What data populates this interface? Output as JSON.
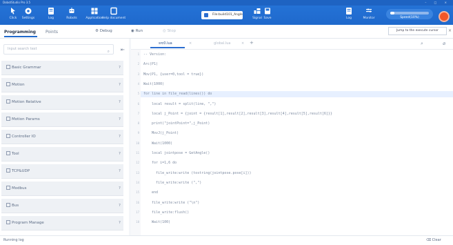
{
  "window": {
    "title": "DobotStudio Pro 3.5",
    "controls": "– □ ×"
  },
  "toolbar": {
    "buttons": [
      {
        "label": "Click",
        "icon": "cursor-icon"
      },
      {
        "label": "Settings",
        "icon": "gear-icon"
      },
      {
        "label": "Log",
        "icon": "log-icon"
      },
      {
        "label": "Robots",
        "icon": "robot-icon"
      },
      {
        "label": "Application",
        "icon": "app-icon"
      },
      {
        "label": "Help document",
        "icon": "help-icon"
      }
    ],
    "file_label": "File:build101_Angle",
    "right_buttons": [
      {
        "label": "Signal",
        "icon": "signal-icon"
      },
      {
        "label": "Save",
        "icon": "save-icon"
      },
      {
        "label": "Log",
        "icon": "log-icon"
      },
      {
        "label": "Monitor",
        "icon": "monitor-icon"
      }
    ],
    "speed_label": "Speed(10%)",
    "speed_fraction": 0.1
  },
  "tabs": {
    "programming": "Programming",
    "points": "Points",
    "debug": "Debug",
    "run": "Run",
    "stop": "Stop",
    "jump": "Jump to the execute cursor",
    "close": "×"
  },
  "sidebar": {
    "search_placeholder": "Input search text",
    "categories": [
      "Basic Grammar",
      "Motion",
      "Motion Relative",
      "Motion Params",
      "Controller IO",
      "Tool",
      "TCP&UDP",
      "Modbus",
      "Bus",
      "Program Manage"
    ],
    "help": "?"
  },
  "editor": {
    "tabs": [
      "src0.lua",
      "global.lua"
    ],
    "close_mark": "×",
    "add_mark": "+",
    "lines": [
      {
        "n": "1",
        "t": "-- Version:"
      },
      {
        "n": "2",
        "t": "Arc(P1)"
      },
      {
        "n": "3",
        "t": "Mov(P1, {user=0,tool = true})"
      },
      {
        "n": "4",
        "t": "Wait(1000)"
      },
      {
        "n": "5",
        "t": "for line in file_read(lines()) do"
      },
      {
        "n": "6",
        "t": "    local result = split(line, \",\")"
      },
      {
        "n": "7",
        "t": "    local j_Point = {joint = {result[1],result[2],result[3],result[4],result[5],result[6]}}"
      },
      {
        "n": "8",
        "t": "    print(\"jointPoint=\",j_Point)"
      },
      {
        "n": "9",
        "t": "    MovJ(j_Point)"
      },
      {
        "n": "10",
        "t": "    Wait(1000)"
      },
      {
        "n": "11",
        "t": "    local jointpose = GetAngle()"
      },
      {
        "n": "12",
        "t": "    for i=1,6 do"
      },
      {
        "n": "13",
        "t": "      file_write:write (tostring(jointpose.pose[i]))"
      },
      {
        "n": "14",
        "t": "      file_write:write (\",\")"
      },
      {
        "n": "15",
        "t": "    end"
      },
      {
        "n": "16",
        "t": "    file_write:write (\"\\n\")"
      },
      {
        "n": "17",
        "t": "    file_write:flush()"
      },
      {
        "n": "18",
        "t": "    Wait(100)"
      }
    ]
  },
  "status": {
    "running_log": "Running log",
    "clear": "Clear"
  }
}
